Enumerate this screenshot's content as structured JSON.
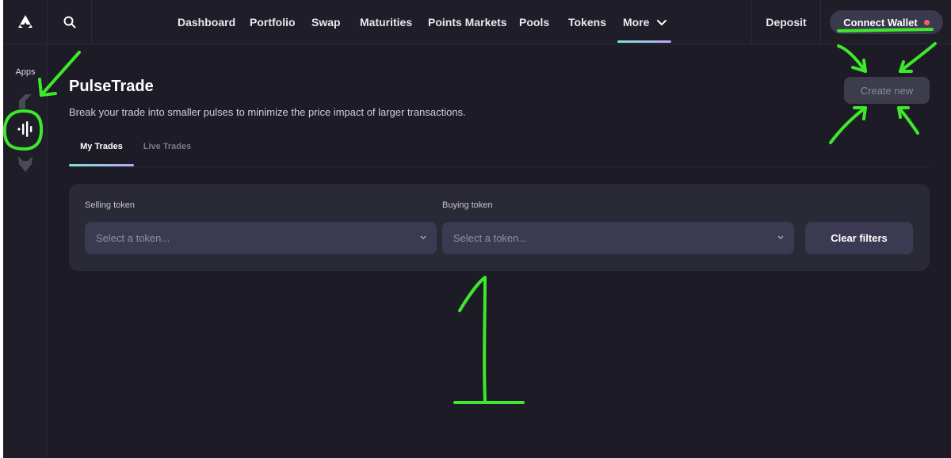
{
  "topnav": {
    "links": [
      "Dashboard",
      "Portfolio",
      "Swap",
      "Maturities",
      "Points Markets",
      "Pools",
      "Tokens",
      "More"
    ],
    "deposit_label": "Deposit",
    "connect_label": "Connect Wallet",
    "icons": {
      "logo": "brand-logo-icon",
      "search": "search-icon",
      "more": "chevron-down-icon"
    }
  },
  "sidebar": {
    "title": "Apps",
    "items": [
      "pendle-app-icon",
      "pulse-trade-icon",
      "fox-app-icon"
    ]
  },
  "page": {
    "title": "PulseTrade",
    "subtitle": "Break your trade into smaller pulses to minimize the price impact of larger transactions.",
    "create_label": "Create new"
  },
  "tabs": [
    "My Trades",
    "Live Trades"
  ],
  "filters": {
    "selling_label": "Selling token",
    "selling_placeholder": "Select a token...",
    "buying_label": "Buying token",
    "buying_placeholder": "Select a token...",
    "clear_label": "Clear filters"
  },
  "annotation": {
    "color": "#3ee82a",
    "number": "1"
  },
  "colors": {
    "background": "#1c1b26",
    "card": "#2a2936",
    "accent_start": "#7de3d5",
    "accent_end": "#b9a6f5",
    "status_dot": "#f2606b"
  }
}
